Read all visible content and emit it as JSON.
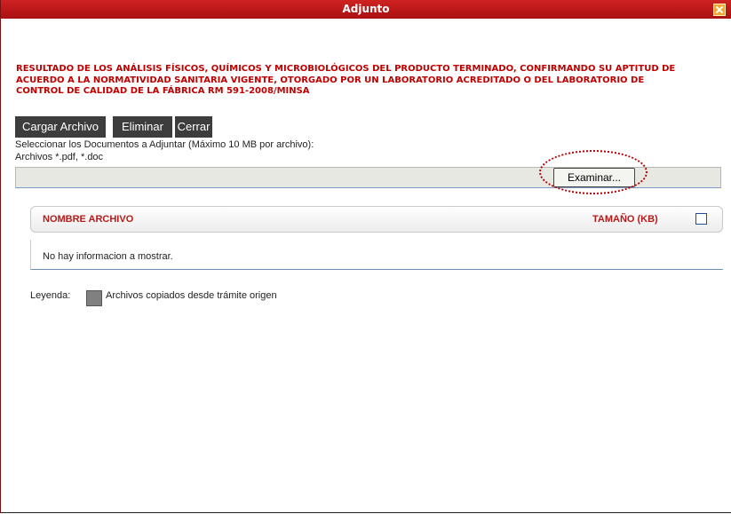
{
  "window": {
    "title": "Adjunto"
  },
  "heading": {
    "line1": "RESULTADO DE LOS ANÁLISIS FÍSICOS, QUÍMICOS Y MICROBIOLÓGICOS DEL PRODUCTO TERMINADO, CONFIRMANDO SU APTITUD DE",
    "line2": "ACUERDO A LA NORMATIVIDAD SANITARIA VIGENTE, OTORGADO POR UN LABORATORIO ACREDITADO O DEL LABORATORIO DE",
    "line3": "CONTROL DE CALIDAD DE LA FÁBRICA RM 591-2008/MINSA"
  },
  "toolbar": {
    "upload_label": "Cargar Archivo",
    "delete_label": "Eliminar",
    "close_label": "Cerrar"
  },
  "upload": {
    "instruction": "Seleccionar los Documentos a Adjuntar (Máximo 10 MB por archivo):",
    "allowed_types": "Archivos *.pdf, *.doc",
    "browse_label": "Examinar..."
  },
  "grid": {
    "columns": [
      "NOMBRE ARCHIVO",
      "TAMAÑO (KB)"
    ],
    "rows": [],
    "empty_message": "No hay informacion a mostrar."
  },
  "legend": {
    "label": "Leyenda:",
    "copied_files": "Archivos copiados desde trámite origen",
    "swatch_color": "#808080"
  },
  "colors": {
    "titlebar": "#b81616",
    "heading_text": "#c00000",
    "toolbar_button": "#3d3d3d",
    "highlight": "#b40000"
  }
}
